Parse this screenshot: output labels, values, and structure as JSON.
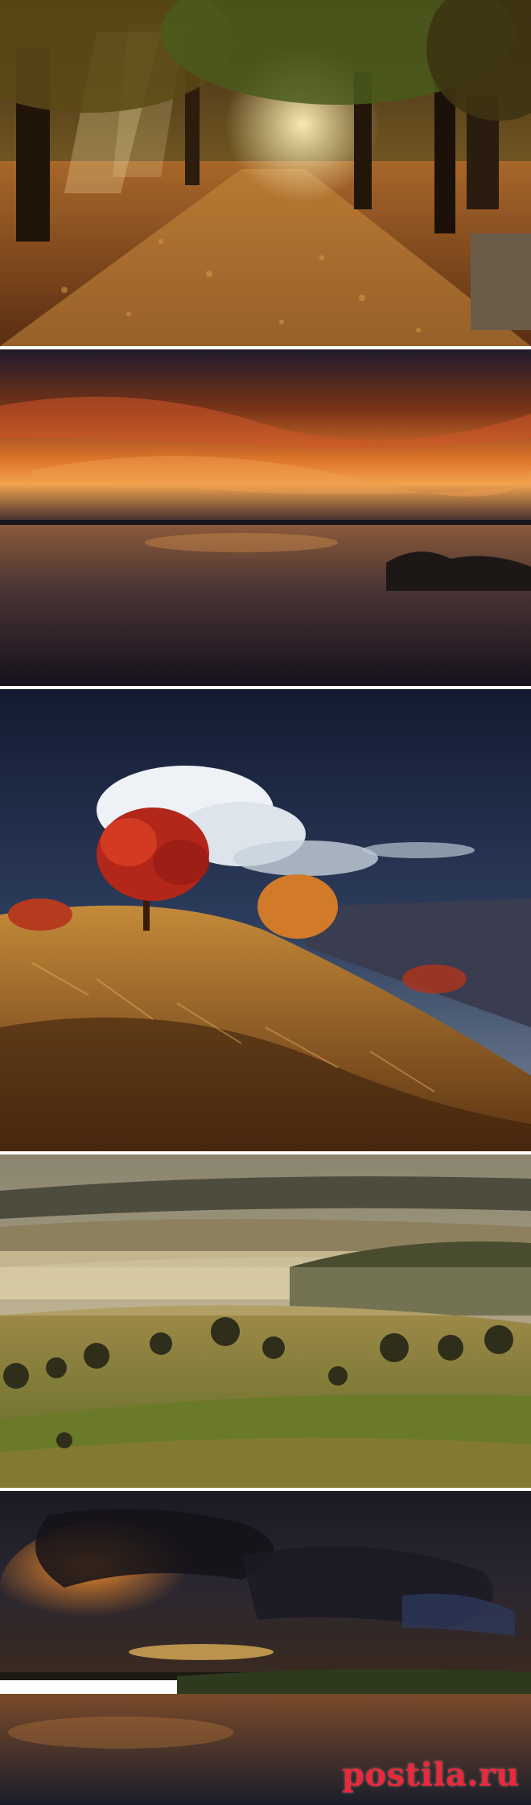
{
  "photos": [
    {
      "subject": "autumn-alley"
    },
    {
      "subject": "sunset-lake"
    },
    {
      "subject": "autumn-hill-tree"
    },
    {
      "subject": "misty-valley"
    },
    {
      "subject": "stormy-sunset-river"
    }
  ],
  "watermark": {
    "text": "postila.ru",
    "color": "#eb283c"
  }
}
